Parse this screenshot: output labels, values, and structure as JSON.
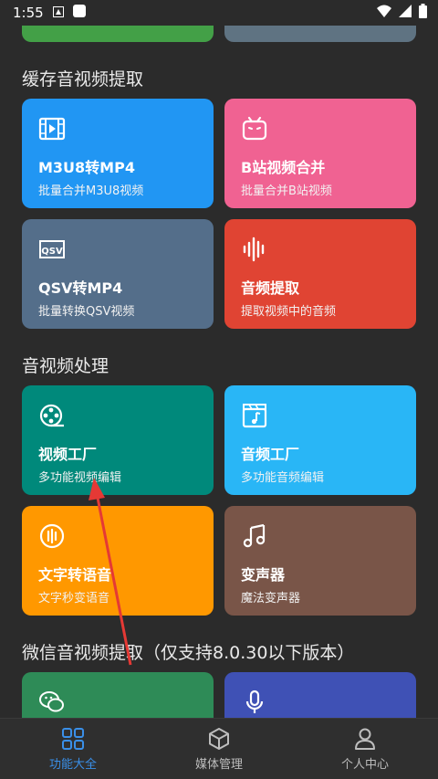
{
  "status_bar": {
    "time": "1:55"
  },
  "sections": [
    {
      "title": "缓存音视频提取"
    },
    {
      "title": "音视频处理"
    },
    {
      "title": "微信音视频提取（仅支持8.0.30以下版本）"
    }
  ],
  "cards": {
    "m3u8": {
      "title": "M3U8转MP4",
      "subtitle": "批量合并M3U8视频",
      "color": "#2196f3"
    },
    "bili": {
      "title": "B站视频合并",
      "subtitle": "批量合并B站视频",
      "color": "#f06292"
    },
    "qsv": {
      "title": "QSV转MP4",
      "subtitle": "批量转换QSV视频",
      "color": "#546e8a"
    },
    "audio_extract": {
      "title": "音频提取",
      "subtitle": "提取视频中的音频",
      "color": "#e04433"
    },
    "video_factory": {
      "title": "视频工厂",
      "subtitle": "多功能视频编辑",
      "color": "#00897b"
    },
    "audio_factory": {
      "title": "音频工厂",
      "subtitle": "多功能音频编辑",
      "color": "#29b6f6"
    },
    "tts": {
      "title": "文字转语音",
      "subtitle": "文字秒变语音",
      "color": "#ff9800"
    },
    "voice_changer": {
      "title": "变声器",
      "subtitle": "魔法变声器",
      "color": "#795548"
    },
    "wechat_video": {
      "color": "#2e8b57"
    },
    "wechat_audio": {
      "color": "#3f51b5"
    }
  },
  "top_partial_cards": {
    "left_color": "#43a047",
    "right_color": "#5f7382"
  },
  "tabbar": {
    "tabs": [
      {
        "label": "功能大全",
        "icon": "grid-icon",
        "active": true
      },
      {
        "label": "媒体管理",
        "icon": "cube-icon",
        "active": false
      },
      {
        "label": "个人中心",
        "icon": "person-icon",
        "active": false
      }
    ]
  }
}
